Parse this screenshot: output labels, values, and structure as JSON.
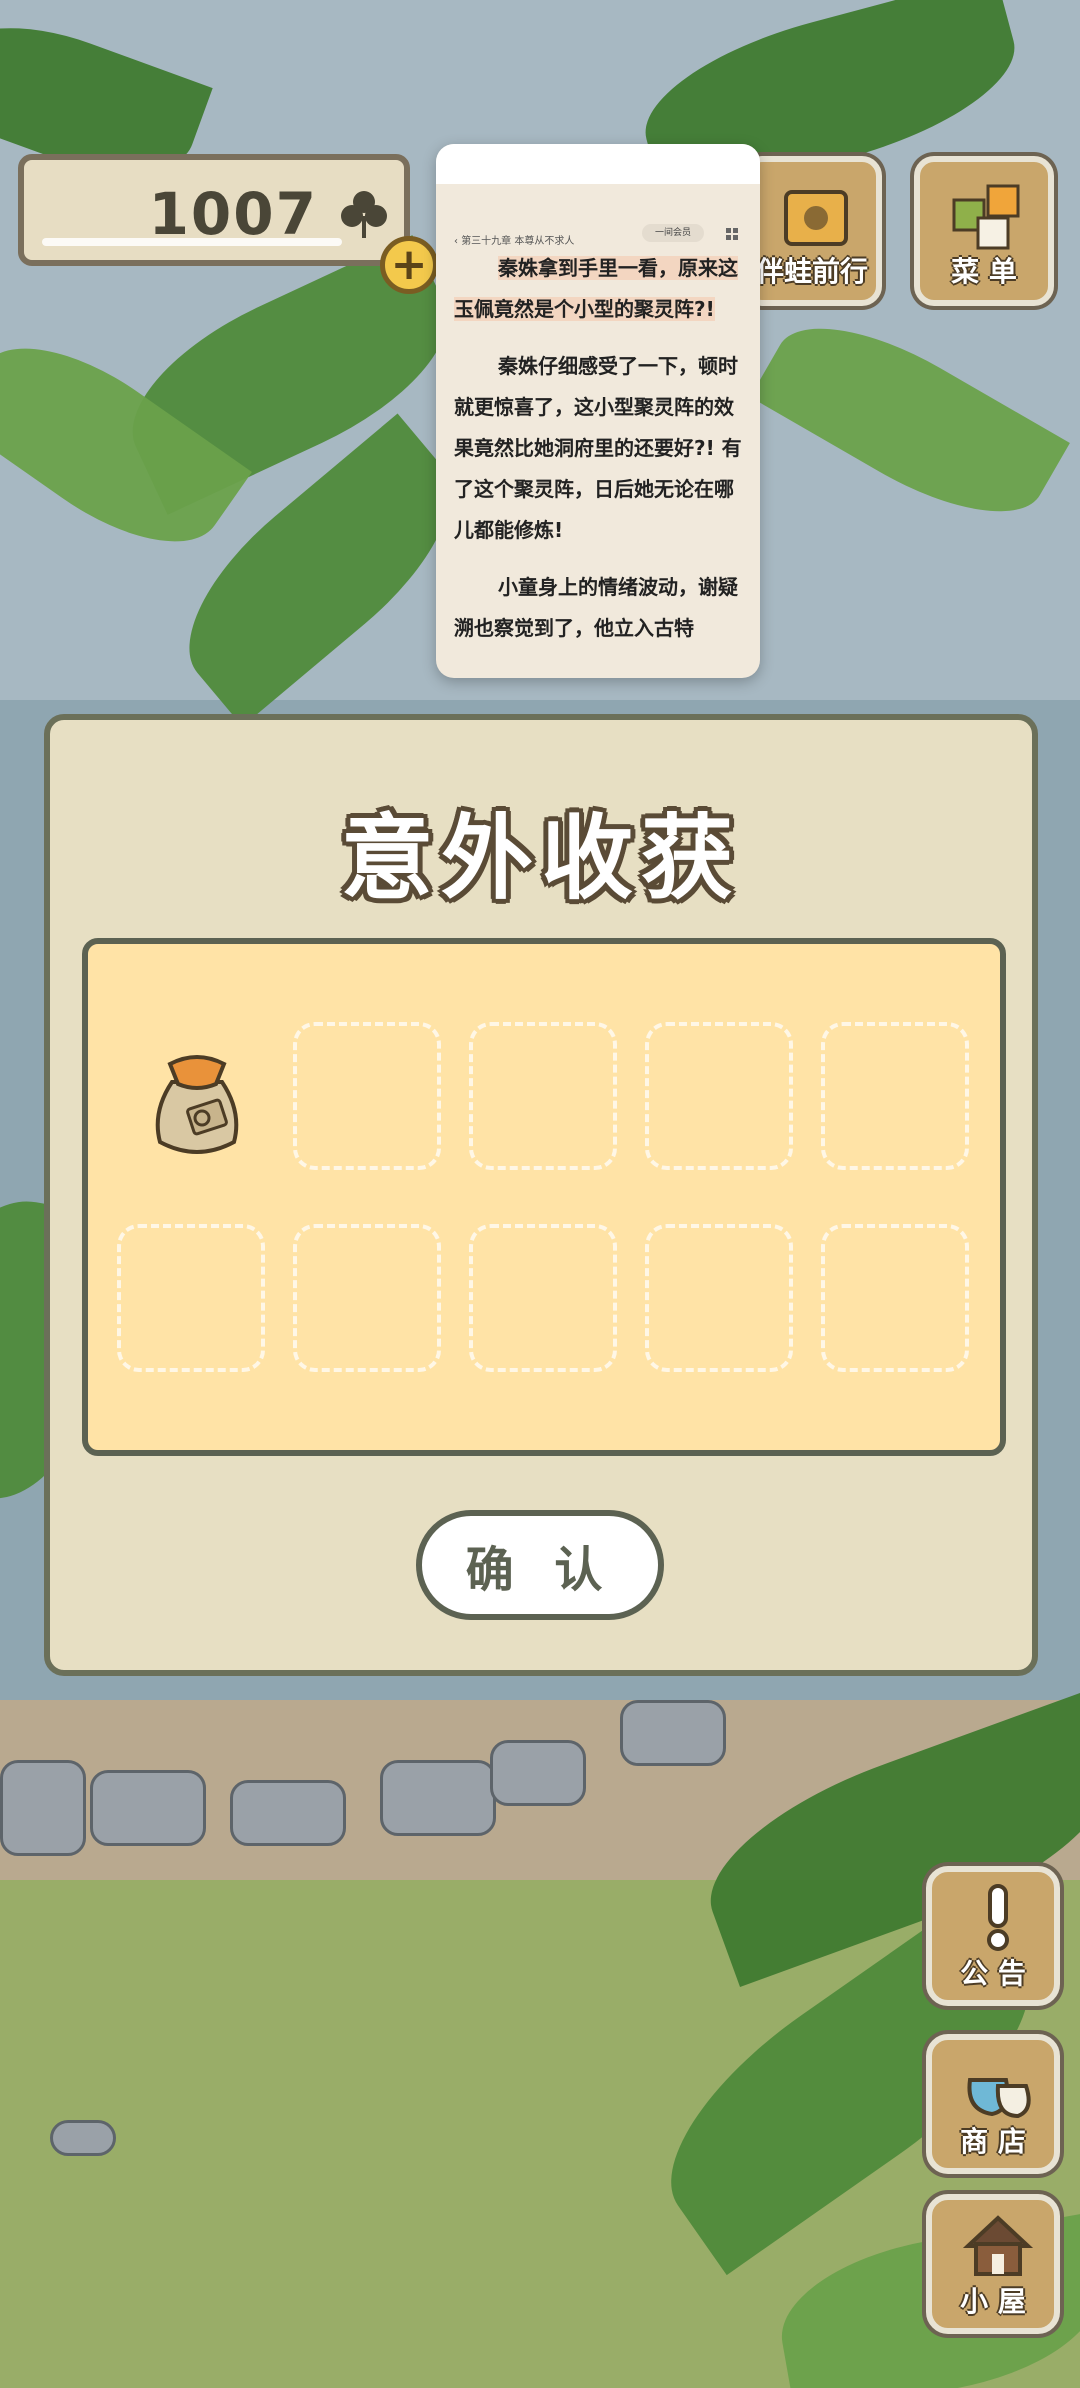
{
  "hud": {
    "coins": "1007",
    "coin_icon": "clover-icon",
    "plus_label": "+",
    "travel_label": "伴蛙前行",
    "menu_label": "菜 单"
  },
  "reader": {
    "chapter": "第三十九章 本尊从不求人",
    "audio_label": "一间会员",
    "paragraphs": [
      "秦姝拿到手里一看，原来这玉佩竟然是个小型的聚灵阵?!",
      "秦姝仔细感受了一下，顿时就更惊喜了，这小型聚灵阵的效果竟然比她洞府里的还要好?! 有了这个聚灵阵，日后她无论在哪儿都能修炼!",
      "小童身上的情绪波动，谢疑溯也察觉到了，他立入古特"
    ]
  },
  "dialog": {
    "title": "意外收获",
    "slots_filled": 1,
    "slots_total": 10,
    "items": [
      {
        "name": "seed-bag",
        "icon": "bag-icon"
      }
    ],
    "confirm_label": "确 认"
  },
  "side": {
    "notice_label": "公 告",
    "shop_label": "商 店",
    "house_label": "小 屋"
  },
  "colors": {
    "panel_bg": "#e7dfc3",
    "slot_area": "#ffe3a6",
    "border": "#5c6252",
    "wood": "#c9a66b"
  }
}
